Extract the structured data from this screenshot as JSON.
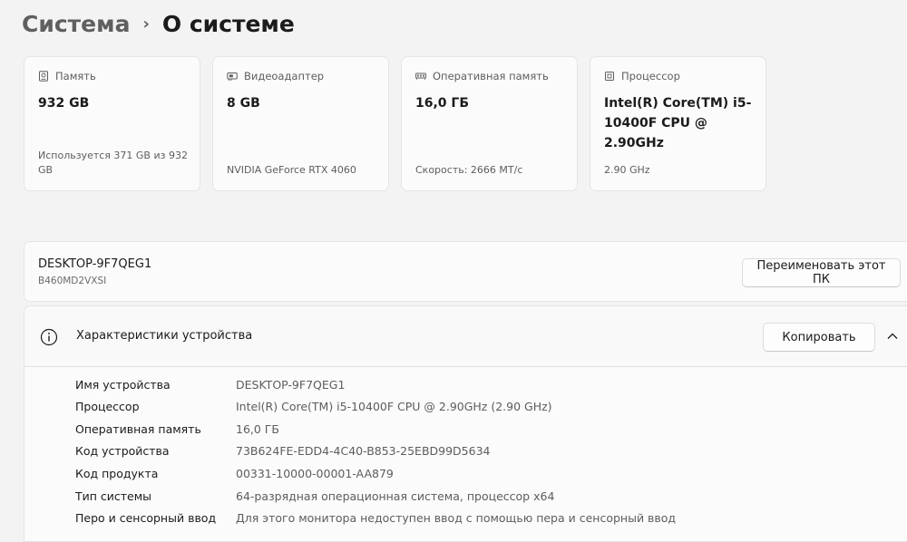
{
  "header": {
    "parent": "Система",
    "separator": "›",
    "current": "О системе"
  },
  "cards": [
    {
      "icon": "storage-icon",
      "label": "Память",
      "value": "932 GB",
      "sub": "Используется 371 GB из 932 GB"
    },
    {
      "icon": "gpu-icon",
      "label": "Видеоадаптер",
      "value": "8 GB",
      "sub": "NVIDIA GeForce RTX 4060"
    },
    {
      "icon": "ram-icon",
      "label": "Оперативная память",
      "value": "16,0 ГБ",
      "sub": "Скорость: 2666 МТ/с"
    },
    {
      "icon": "cpu-icon",
      "label": "Процессор",
      "value": "Intel(R) Core(TM) i5-10400F CPU @ 2.90GHz",
      "sub": "2.90 GHz"
    }
  ],
  "pc": {
    "name": "DESKTOP-9F7QEG1",
    "model": "B460MD2VXSI",
    "rename_label": "Переименовать этот ПК"
  },
  "specs": {
    "title": "Характеристики устройства",
    "copy_label": "Копировать",
    "rows": [
      {
        "label": "Имя устройства",
        "value": "DESKTOP-9F7QEG1"
      },
      {
        "label": "Процессор",
        "value": "Intel(R) Core(TM) i5-10400F CPU @ 2.90GHz (2.90 GHz)"
      },
      {
        "label": "Оперативная память",
        "value": "16,0 ГБ"
      },
      {
        "label": "Код устройства",
        "value": "73B624FE-EDD4-4C40-B853-25EBD99D5634"
      },
      {
        "label": "Код продукта",
        "value": "00331-10000-00001-AA879"
      },
      {
        "label": "Тип системы",
        "value": "64-разрядная операционная система, процессор x64"
      },
      {
        "label": "Перо и сенсорный ввод",
        "value": "Для этого монитора недоступен ввод с помощью пера и сенсорный ввод"
      }
    ]
  }
}
